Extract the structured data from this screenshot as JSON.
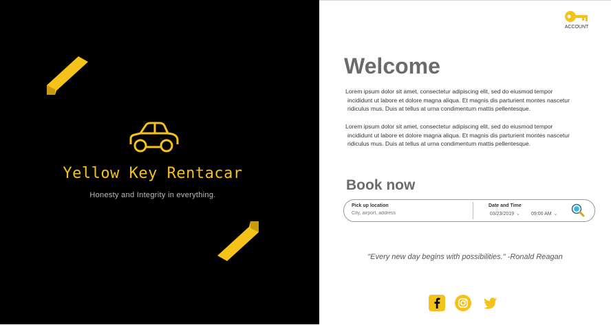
{
  "brand": {
    "name": "Yellow Key Rentacar",
    "tagline": "Honesty and Integrity in everything."
  },
  "header": {
    "account_label": "ACCOUNT"
  },
  "welcome": {
    "title": "Welcome",
    "paragraph1": [
      "Lorem ipsum dolor sit amet, consectetur adipiscing elit, sed do eiusmod tempor",
      "incididunt ut labore et dolore magna aliqua. Et magnis dis parturient montes nascetur",
      "ridiculus mus. Duis at tellus at urna condimentum mattis pellentesque."
    ],
    "paragraph2": [
      "Lorem ipsum dolor sit amet, consectetur adipiscing elit, sed do eiusmod tempor",
      "incididunt ut labore et dolore magna aliqua. Et magnis dis parturient montes nascetur",
      "ridiculus mus. Duis at tellus at urna condimentum mattis pellentesque."
    ]
  },
  "booking": {
    "title": "Book now",
    "pickup_label": "Pick up location",
    "pickup_placeholder": "City, airport, address",
    "date_label": "Date and Time",
    "date_value": "03/23/2019",
    "time_value": "09:00  AM",
    "search_icon": "magnifier-icon"
  },
  "quote": "\"Every new day begins with possibilities.\" -Ronald Reagan",
  "social": [
    "facebook-icon",
    "instagram-icon",
    "twitter-icon"
  ],
  "colors": {
    "accent": "#f5c21b",
    "left_background": "#000000",
    "heading": "#6b6b6b"
  }
}
